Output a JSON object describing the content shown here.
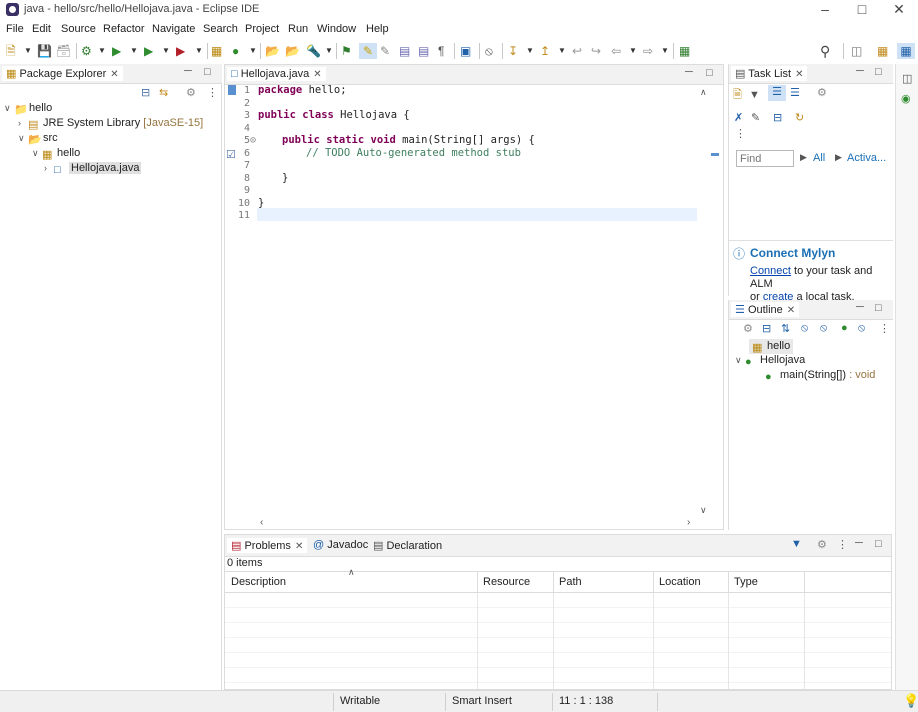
{
  "window": {
    "title": "java - hello/src/hello/Hellojava.java - Eclipse IDE"
  },
  "menu": [
    "File",
    "Edit",
    "Source",
    "Refactor",
    "Navigate",
    "Search",
    "Project",
    "Run",
    "Window",
    "Help"
  ],
  "package_explorer": {
    "tab": "Package Explorer",
    "project": "hello",
    "jre_label": "JRE System Library",
    "jre_version": "[JavaSE-15]",
    "src": "src",
    "package": "hello",
    "file": "Hellojava.java"
  },
  "editor": {
    "tab": "Hellojava.java",
    "line_numbers": [
      "1",
      "2",
      "3",
      "4",
      "5⊝",
      "6",
      "7",
      "8",
      "9",
      "10",
      "11"
    ],
    "lines": {
      "l1_kw": "package",
      "l1_rest": " hello;",
      "l3_kw": "public class",
      "l3_rest": " Hellojava {",
      "l5_kw": "public static void",
      "l5_rest": " main(String[] args) {",
      "l6_comment": "// TODO Auto-generated method stub",
      "l8": "}",
      "l10": "}"
    }
  },
  "task_list": {
    "tab": "Task List",
    "find_placeholder": "Find",
    "all": "All",
    "activate": "Activa...",
    "mylyn_title": "Connect Mylyn",
    "mylyn_connect": "Connect",
    "mylyn_text1": " to your task and ALM",
    "mylyn_or": "or ",
    "mylyn_create": "create",
    "mylyn_text2": " a local task."
  },
  "outline": {
    "tab": "Outline",
    "package": "hello",
    "class": "Hellojava",
    "method": "main(String[])",
    "method_type": " : void"
  },
  "problems": {
    "tabs": [
      "Problems",
      "Javadoc",
      "Declaration"
    ],
    "count": "0 items",
    "columns": [
      "Description",
      "Resource",
      "Path",
      "Location",
      "Type"
    ]
  },
  "status": {
    "writable": "Writable",
    "insert": "Smart Insert",
    "position": "11 : 1 : 138"
  },
  "colors": {
    "keyword": "#7f0055",
    "comment": "#3f7f5f",
    "link": "#0645ad",
    "mylyn": "#1a6fb5"
  }
}
